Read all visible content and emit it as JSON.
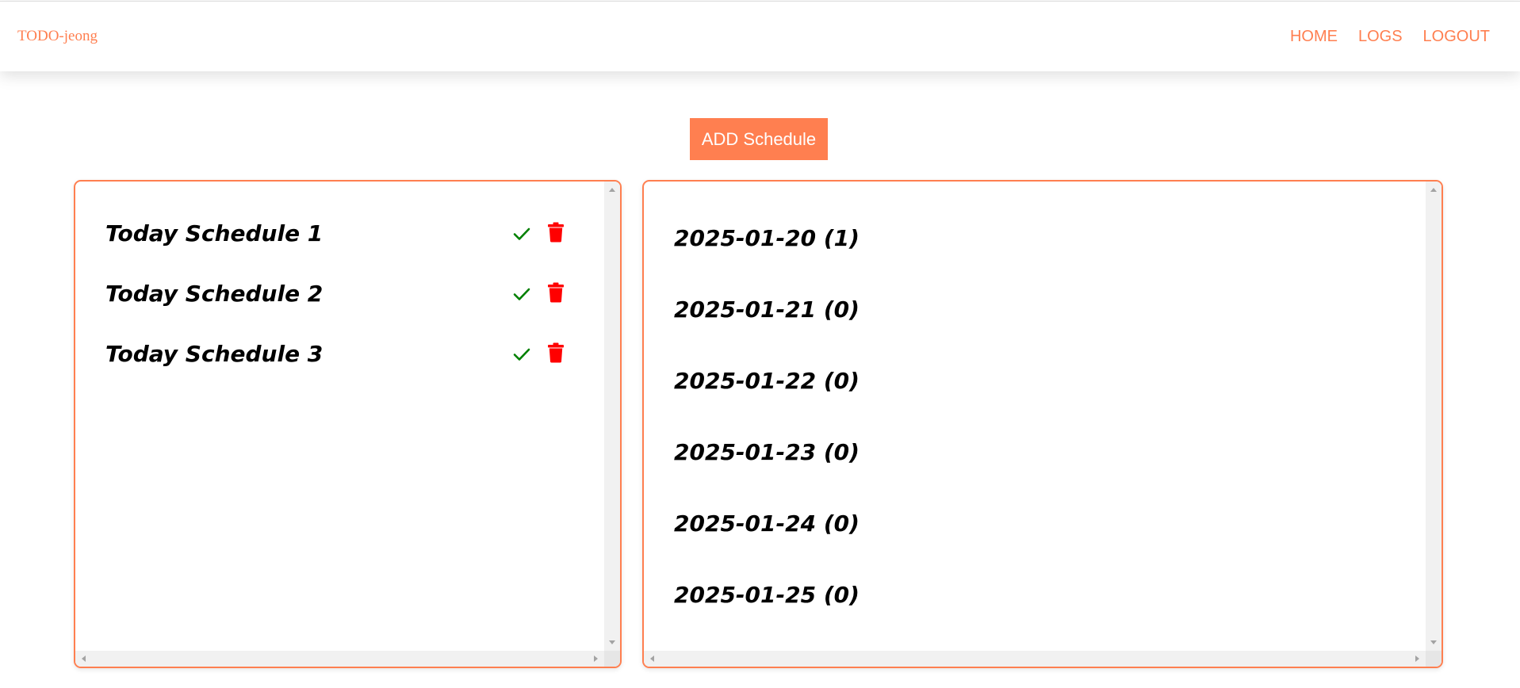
{
  "navbar": {
    "brand": "TODO-jeong",
    "links": [
      "HOME",
      "LOGS",
      "LOGOUT"
    ]
  },
  "actions": {
    "add_label": "ADD Schedule"
  },
  "today_schedules": [
    {
      "title": "Today Schedule 1",
      "complete_icon": "check-icon",
      "delete_icon": "trash-icon"
    },
    {
      "title": "Today Schedule 2",
      "complete_icon": "check-icon",
      "delete_icon": "trash-icon"
    },
    {
      "title": "Today Schedule 3",
      "complete_icon": "check-icon",
      "delete_icon": "trash-icon"
    }
  ],
  "date_logs": [
    "2025-01-20 (1)",
    "2025-01-21 (0)",
    "2025-01-22 (0)",
    "2025-01-23 (0)",
    "2025-01-24 (0)",
    "2025-01-25 (0)"
  ],
  "colors": {
    "accent": "#ff7f50",
    "check": "#008000",
    "delete": "#ff0000",
    "text": "#000000"
  }
}
